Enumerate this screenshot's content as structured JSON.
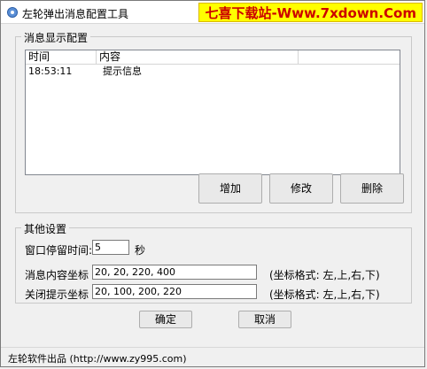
{
  "window": {
    "title": "左轮弹出消息配置工具",
    "watermark": "七喜下载站-Www.7xdown.Com"
  },
  "message_group": {
    "label": "消息显示配置",
    "columns": [
      "时间",
      "内容"
    ],
    "rows": [
      {
        "time": "18:53:11",
        "content": "提示信息"
      }
    ],
    "buttons": {
      "add": "增加",
      "edit": "修改",
      "delete": "删除"
    }
  },
  "other_group": {
    "label": "其他设置",
    "dwell_label": "窗口停留时间:",
    "dwell_value": "5",
    "dwell_unit": "秒",
    "content_coord_label": "消息内容坐标",
    "content_coord_value": "20, 20, 220, 400",
    "close_coord_label": "关闭提示坐标",
    "close_coord_value": "20, 100, 200, 220",
    "coord_hint": "(坐标格式: 左,上,右,下)"
  },
  "dialog_buttons": {
    "ok": "确定",
    "cancel": "取消"
  },
  "status": {
    "text": "左轮软件出品 (http://www.zy995.com)"
  }
}
